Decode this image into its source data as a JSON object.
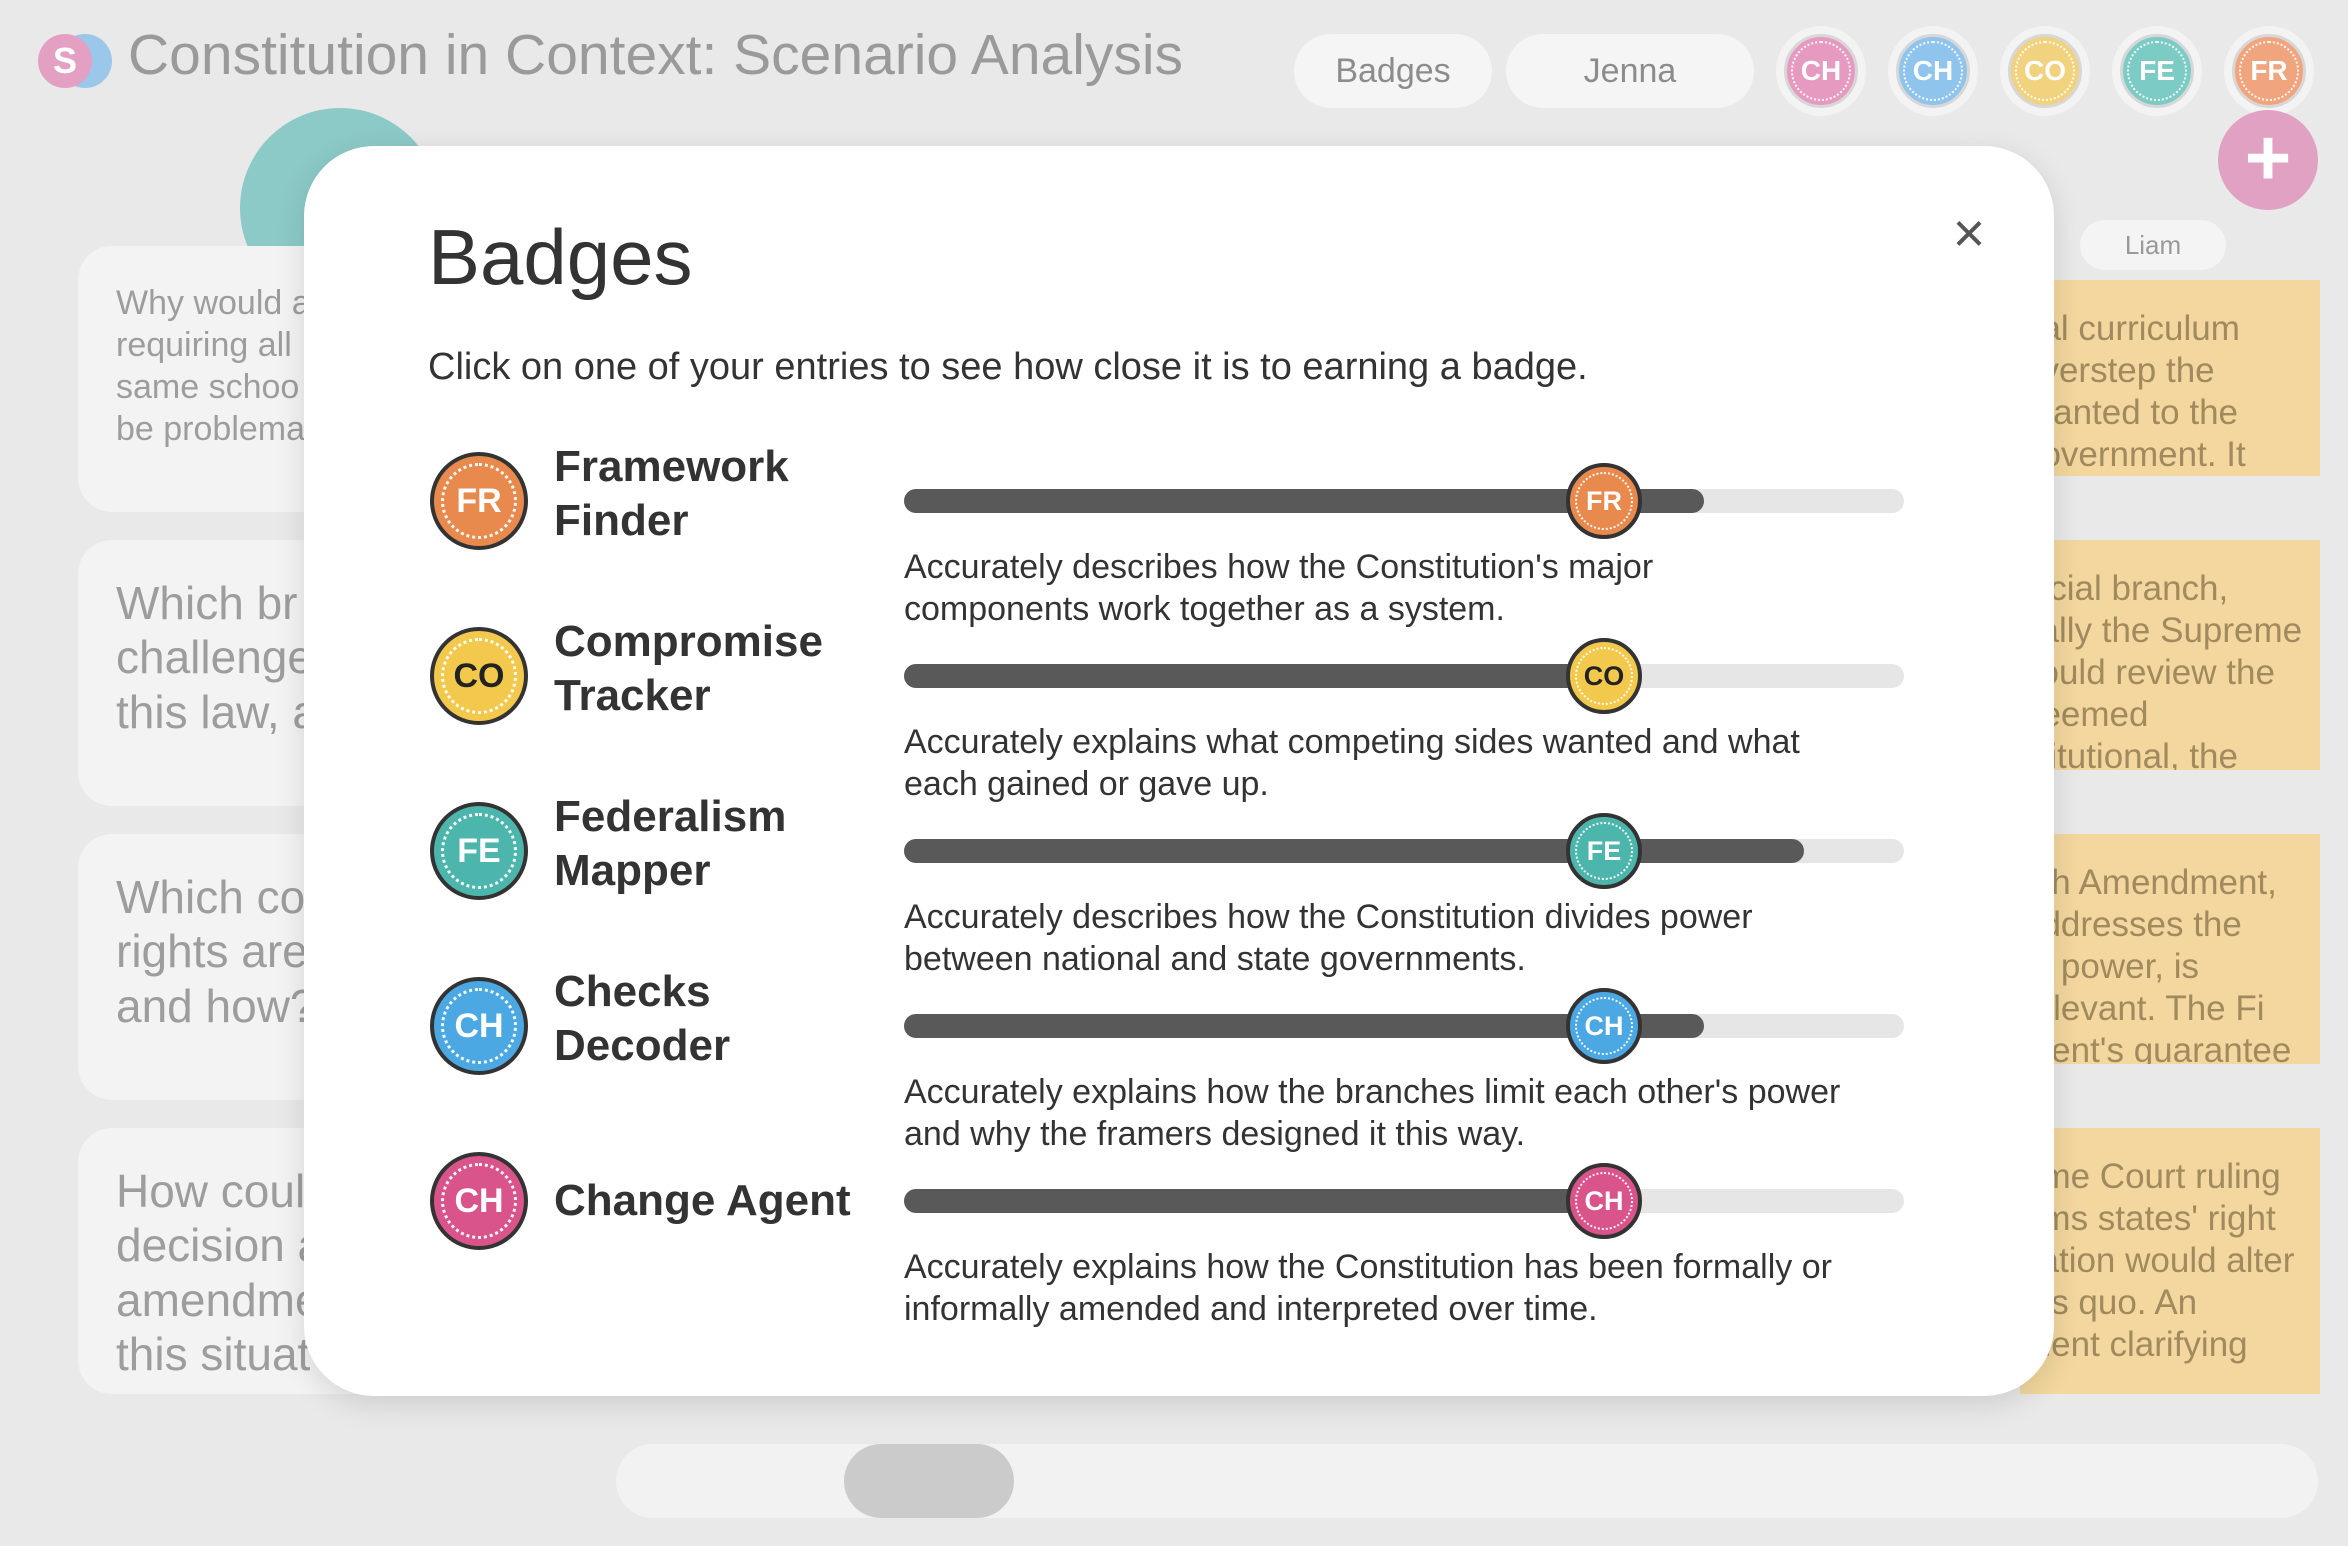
{
  "app": {
    "logo_letter": "S",
    "title": "Constitution in Context: Scenario Analysis",
    "badges_button": "Badges",
    "user_button": "Jenna",
    "add_label": "+"
  },
  "header_badges": [
    {
      "abbr": "CH",
      "color": "#e79ac0"
    },
    {
      "abbr": "CH",
      "color": "#8fc4ec"
    },
    {
      "abbr": "CO",
      "color": "#f1d27e"
    },
    {
      "abbr": "FE",
      "color": "#7ccbc5"
    },
    {
      "abbr": "FR",
      "color": "#f0a57e"
    }
  ],
  "background": {
    "left_cards": [
      "Why would a\nrequiring all\nsame schoo\nbe problema",
      "Which br\nchallenge\nthis law, a",
      "Which co\nrights are\nand how?",
      "How coul\ndecision a\namendme\nthis situat"
    ],
    "right_user": "Liam",
    "right_cards": [
      "nal curriculum\noverstep the\ngranted to the\ngovernment. It\nnot suit the",
      "dicial branch,\ncally the Supreme\ncould review the\ndeemed\nstitutional, the",
      "nth Amendment,\naddresses the\nof power, is\nrelevant. The Fi\nment's guarantee",
      "eme Court ruling\nirms states' right\ncation would alter\ntus quo. An\nment clarifying"
    ]
  },
  "modal": {
    "title": "Badges",
    "subtitle": "Click on one of your entries to see how close it is to earning a badge.",
    "close_label": "×",
    "badges": [
      {
        "abbr": "FR",
        "name": "Framework\nFinder",
        "color": "#e88a4d",
        "text_color": "#ffffff",
        "progress": 0.8,
        "marker": 0.7,
        "description": "Accurately describes how the Constitution's major\ncomponents work together as a system."
      },
      {
        "abbr": "CO",
        "name": "Compromise\nTracker",
        "color": "#f2c94c",
        "text_color": "#222222",
        "progress": 0.7,
        "marker": 0.7,
        "description": "Accurately explains what competing sides wanted and what\neach gained or gave up."
      },
      {
        "abbr": "FE",
        "name": "Federalism\nMapper",
        "color": "#4db6ac",
        "text_color": "#ffffff",
        "progress": 0.9,
        "marker": 0.7,
        "description": "Accurately describes how the Constitution divides power\nbetween national and state governments."
      },
      {
        "abbr": "CH",
        "name": "Checks\nDecoder",
        "color": "#4ba8e3",
        "text_color": "#ffffff",
        "progress": 0.8,
        "marker": 0.7,
        "description": "Accurately explains how the branches limit each other's power\nand why the framers designed it this way."
      },
      {
        "abbr": "CH",
        "name": "Change Agent",
        "color": "#d9548a",
        "text_color": "#ffffff",
        "progress": 0.7,
        "marker": 0.7,
        "description": "Accurately explains how the Constitution has been formally or\ninformally amended and interpreted over time."
      }
    ]
  }
}
